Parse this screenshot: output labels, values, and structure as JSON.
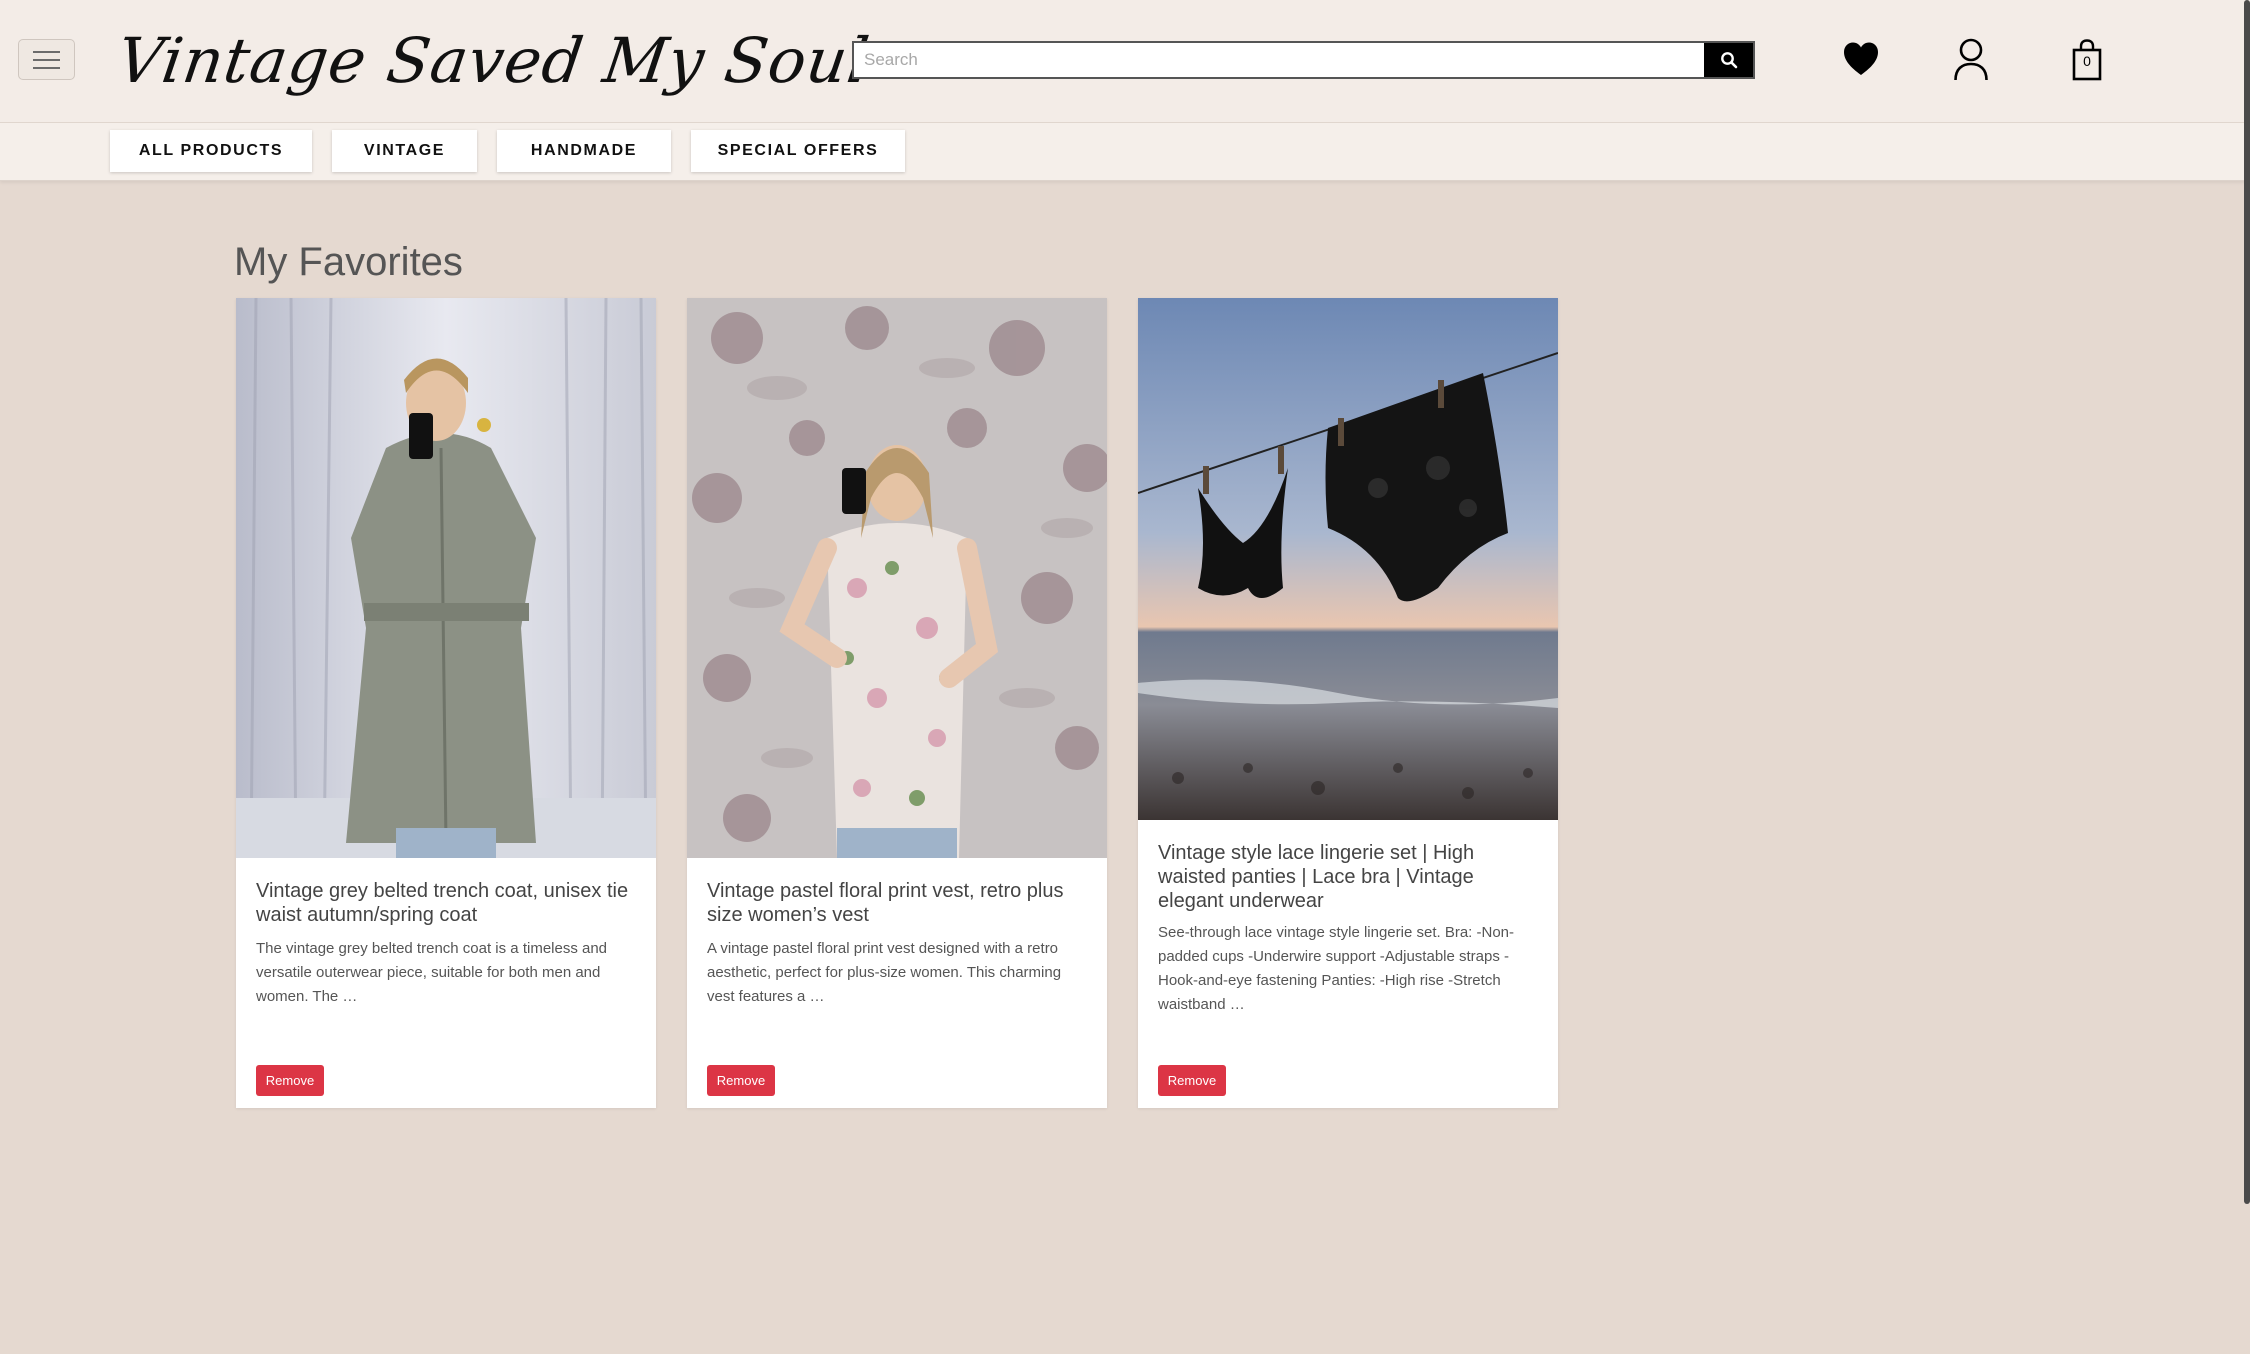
{
  "header": {
    "logo_text": "Vintage Saved My Soul",
    "search_placeholder": "Search",
    "cart_count": "0",
    "icons": [
      "menu-icon",
      "search-icon",
      "heart-icon",
      "user-icon",
      "shopping-bag-icon"
    ]
  },
  "nav": {
    "items": [
      {
        "label": "ALL PRODUCTS"
      },
      {
        "label": "VINTAGE"
      },
      {
        "label": "HANDMADE"
      },
      {
        "label": "SPECIAL OFFERS"
      }
    ]
  },
  "main": {
    "title": "My Favorites",
    "cards": [
      {
        "title": "Vintage grey belted trench coat, unisex tie waist autumn/spring coat",
        "description": "The vintage grey belted trench coat is a timeless and versatile outerwear piece, suitable for both men and women. The …",
        "remove_label": "Remove"
      },
      {
        "title": "Vintage pastel floral print vest, retro plus size women’s vest",
        "description": "A vintage pastel floral print vest designed with a retro aesthetic, perfect for plus-size women. This charming vest features a …",
        "remove_label": "Remove"
      },
      {
        "title": "Vintage style lace lingerie set | High waisted panties | Lace bra | Vintage elegant underwear",
        "description": "See-through lace vintage style lingerie set. Bra: -Non-padded cups -Underwire support -Adjustable straps -Hook-and-eye fastening Panties: -High rise -Stretch waistband …",
        "remove_label": "Remove"
      }
    ]
  },
  "colors": {
    "page_background": "#e5d9d0",
    "header_background": "#f3ece7",
    "remove_button": "#dc3545",
    "search_button": "#000000"
  }
}
